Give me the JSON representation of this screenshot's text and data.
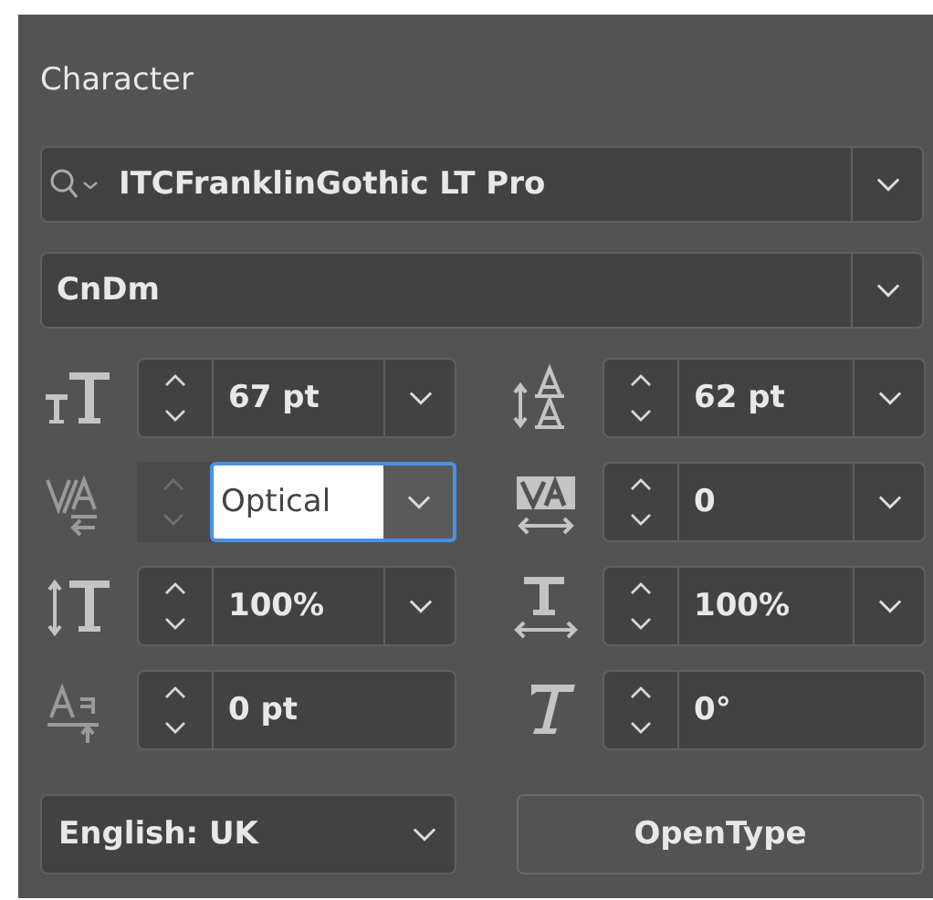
{
  "panel": {
    "title": "Character"
  },
  "font_family": {
    "value": "ITCFranklinGothic LT Pro"
  },
  "font_style": {
    "value": "CnDm"
  },
  "fields": [
    {
      "value": "67 pt",
      "menu": true,
      "focused": false,
      "disabled": false
    },
    {
      "value": "62 pt",
      "menu": true,
      "focused": false,
      "disabled": false
    },
    {
      "value": "Optical",
      "menu": true,
      "focused": true,
      "disabled": true
    },
    {
      "value": "0",
      "menu": true,
      "focused": false,
      "disabled": false
    },
    {
      "value": "100%",
      "menu": true,
      "focused": false,
      "disabled": false
    },
    {
      "value": "100%",
      "menu": true,
      "focused": false,
      "disabled": false
    },
    {
      "value": "0 pt",
      "menu": false,
      "focused": false,
      "disabled": false
    },
    {
      "value": "0°",
      "menu": false,
      "focused": false,
      "disabled": false
    }
  ],
  "language": {
    "value": "English: UK"
  },
  "buttons": [
    "OpenType"
  ]
}
